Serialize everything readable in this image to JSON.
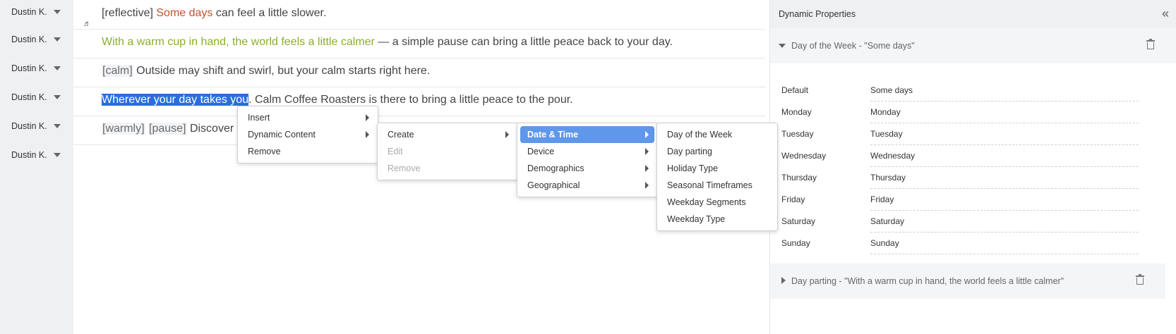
{
  "speakers": [
    "Dustin K.",
    "Dustin K.",
    "Dustin K.",
    "Dustin K.",
    "Dustin K.",
    "Dustin K."
  ],
  "lines": [
    {
      "tag": "[reflective]",
      "dynamic": "Some days",
      "rest": " can feel a little slower."
    },
    {
      "dynamic": "With a warm cup in hand, the world feels a little calmer",
      "rest": " — a simple pause can bring a little peace back to your day."
    },
    {
      "tag": "[calm]",
      "rest": "  Outside may shift and swirl, but your calm starts right here."
    },
    {
      "selected": "Wherever your day takes you",
      "rest": ". Calm Coffee Roasters is there to bring a little peace to the pour."
    },
    {
      "tag1": "[warmly]",
      "tag2": "[pause]",
      "rest": "  Discover y"
    }
  ],
  "icons": {
    "music": "music-note-icon",
    "collapse": "double-chevron-left-icon",
    "trash": "trash-icon"
  },
  "colors": {
    "dynamic_orange": "#c1532f",
    "dynamic_green": "#8cae2b",
    "selection": "#2a6fd9",
    "menu_active": "#5f97ea"
  },
  "panel": {
    "title": "Dynamic Properties",
    "collapse_glyph": "«",
    "group1": {
      "title": "Day of the Week - \"Some days\"",
      "rows": [
        {
          "label": "Default",
          "value": "Some days"
        },
        {
          "label": "Monday",
          "value": "Monday"
        },
        {
          "label": "Tuesday",
          "value": "Tuesday"
        },
        {
          "label": "Wednesday",
          "value": "Wednesday"
        },
        {
          "label": "Thursday",
          "value": "Thursday"
        },
        {
          "label": "Friday",
          "value": "Friday"
        },
        {
          "label": "Saturday",
          "value": "Saturday"
        },
        {
          "label": "Sunday",
          "value": "Sunday"
        }
      ]
    },
    "group2": {
      "title": "Day parting - \"With a warm cup in hand, the world feels a little calmer\""
    }
  },
  "menus": {
    "main": [
      "Insert",
      "Dynamic Content",
      "Remove"
    ],
    "dynamic_content": [
      "Create",
      "Edit",
      "Remove"
    ],
    "create": [
      "Date & Time",
      "Device",
      "Demographics",
      "Geographical"
    ],
    "date_time": [
      "Day of the Week",
      "Day parting",
      "Holiday Type",
      "Seasonal Timeframes",
      "Weekday Segments",
      "Weekday Type"
    ]
  }
}
